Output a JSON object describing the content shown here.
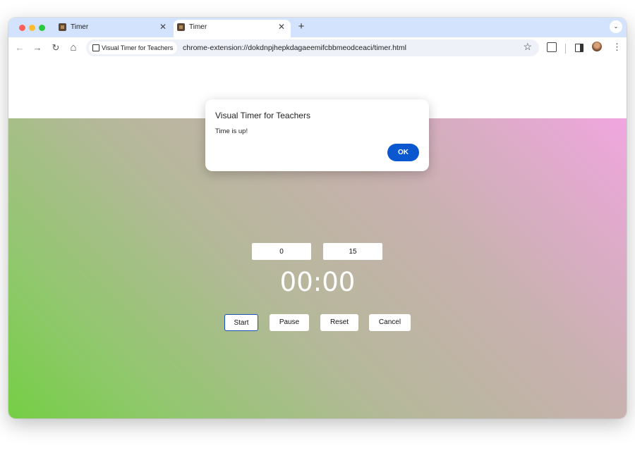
{
  "tabs": [
    {
      "label": "Timer",
      "active": false
    },
    {
      "label": "Timer",
      "active": true
    }
  ],
  "tab_close_glyph": "✕",
  "new_tab_glyph": "+",
  "toolbar": {
    "back_glyph": "←",
    "forward_glyph": "→",
    "reload_glyph": "↻",
    "home_glyph": "⌂",
    "site_chip": "Visual Timer for Teachers",
    "url": "chrome-extension://dokdnpjhepkdagaeemifcbbmeodceaci/timer.html",
    "bookmark_glyph": "☆",
    "menu_glyph": "⋮",
    "tab_search_glyph": "⌄"
  },
  "dialog": {
    "title": "Visual Timer for Teachers",
    "message": "Time is up!",
    "ok_label": "OK"
  },
  "timer": {
    "minutes_value": "0",
    "seconds_value": "15",
    "display": "00:00",
    "start_label": "Start",
    "pause_label": "Pause",
    "reset_label": "Reset",
    "cancel_label": "Cancel"
  },
  "colors": {
    "gradient_top_right": "#f0a6df",
    "gradient_bottom_left": "#6dd03a",
    "ok_button": "#0b57d0",
    "tabstrip": "#d3e3fd"
  }
}
